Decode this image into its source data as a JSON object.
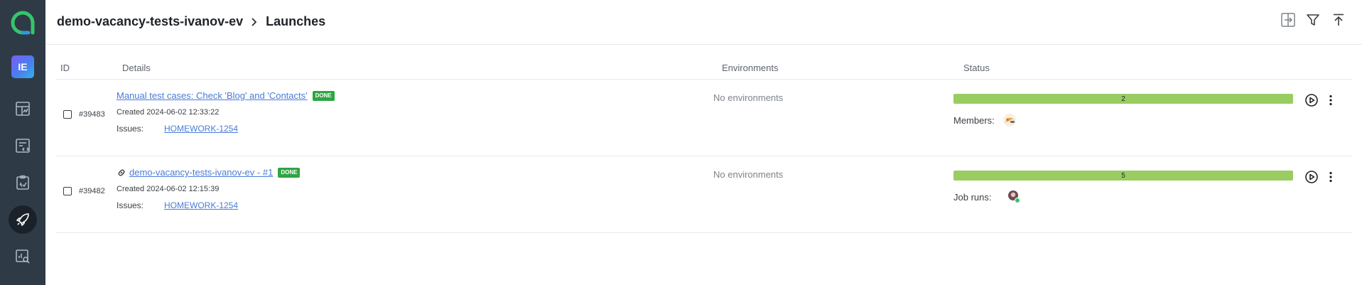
{
  "sidebar": {
    "logo_icon": "allure-logo-icon",
    "project_initials": "IE",
    "items": [
      {
        "icon": "dashboard-icon",
        "active": false
      },
      {
        "icon": "test-cases-icon",
        "active": false
      },
      {
        "icon": "test-plans-icon",
        "active": false
      },
      {
        "icon": "launches-rocket-icon",
        "active": true
      },
      {
        "icon": "analytics-icon",
        "active": false
      }
    ]
  },
  "header": {
    "project_name": "demo-vacancy-tests-ivanov-ev",
    "page_title": "Launches",
    "icons": [
      "compare-icon",
      "filter-icon",
      "upload-icon"
    ]
  },
  "table": {
    "columns": {
      "id": "ID",
      "details": "Details",
      "environments": "Environments",
      "status": "Status"
    },
    "rows": [
      {
        "id": "#39483",
        "title": "Manual test cases: Check 'Blog' and 'Contacts'",
        "has_link_icon": false,
        "badge": "DONE",
        "created": "Created 2024-06-02 12:33:22",
        "issues_label": "Issues:",
        "issue": "HOMEWORK-1254",
        "environments": "No environments",
        "progress_value": "2",
        "progress_fraction": 1.0,
        "members_label": "Members:"
      },
      {
        "id": "#39482",
        "title": "demo-vacancy-tests-ivanov-ev - #1",
        "has_link_icon": true,
        "badge": "DONE",
        "created": "Created 2024-06-02 12:15:39",
        "issues_label": "Issues:",
        "issue": "HOMEWORK-1254",
        "environments": "No environments",
        "progress_value": "5",
        "progress_fraction": 1.0,
        "members_label": "Job runs:"
      }
    ]
  },
  "colors": {
    "sidebar_bg": "#2e3b47",
    "accent_green": "#99cd62",
    "badge_green": "#2ea543",
    "link_blue": "#4a7bd6"
  }
}
